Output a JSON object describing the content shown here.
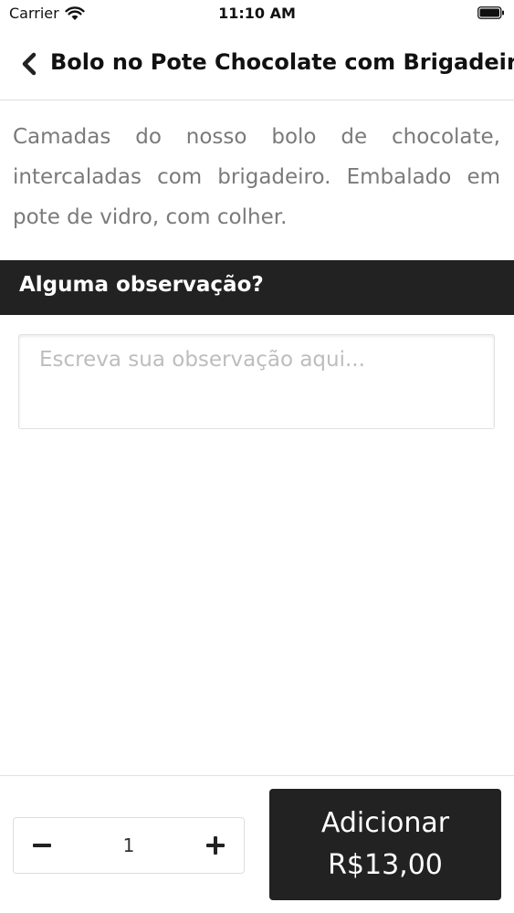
{
  "status_bar": {
    "carrier": "Carrier",
    "time": "11:10 AM",
    "icons": [
      "wifi-icon",
      "battery-icon"
    ]
  },
  "nav": {
    "back_icon": "chevron-left-icon",
    "title": "Bolo no Pote Chocolate com Brigadeiro"
  },
  "product": {
    "description": "Camadas do nosso bolo de chocolate, intercaladas com brigadeiro. Embalado em pote de vidro, com colher."
  },
  "observation": {
    "header": "Alguma observação?",
    "placeholder": "Escreva sua observação aqui...",
    "value": ""
  },
  "footer": {
    "quantity": "1",
    "minus_icon": "minus-icon",
    "plus_icon": "plus-icon",
    "add_label": "Adicionar",
    "price": "R$13,00"
  },
  "colors": {
    "dark": "#222222",
    "muted_text": "#7a7a7a",
    "placeholder": "#bdbdbd",
    "white": "#ffffff"
  }
}
